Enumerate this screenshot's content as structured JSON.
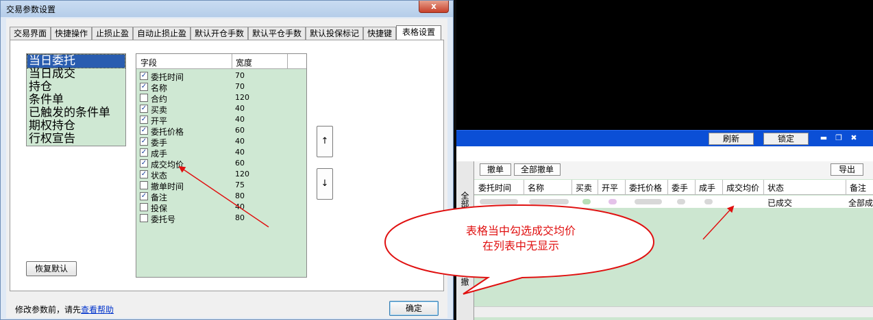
{
  "dialog": {
    "title": "交易参数设置",
    "close_label": "x",
    "tabs": [
      "交易界面",
      "快捷操作",
      "止损止盈",
      "自动止损止盈",
      "默认开仓手数",
      "默认平仓手数",
      "默认投保标记",
      "快捷键",
      "表格设置"
    ],
    "active_tab": "表格设置",
    "table_types": [
      "当日委托",
      "当日成交",
      "持仓",
      "条件单",
      "已触发的条件单",
      "期权持仓",
      "行权宣告"
    ],
    "selected_table_type": "当日委托",
    "grid_headers": {
      "field": "字段",
      "width": "宽度"
    },
    "fields": [
      {
        "name": "委托时间",
        "width": "70",
        "checked": "✓"
      },
      {
        "name": "名称",
        "width": "70",
        "checked": "✓"
      },
      {
        "name": "合约",
        "width": "120",
        "checked": ""
      },
      {
        "name": "买卖",
        "width": "40",
        "checked": "✓"
      },
      {
        "name": "开平",
        "width": "40",
        "checked": "✓"
      },
      {
        "name": "委托价格",
        "width": "60",
        "checked": "✓"
      },
      {
        "name": "委手",
        "width": "40",
        "checked": "✓"
      },
      {
        "name": "成手",
        "width": "40",
        "checked": "✓"
      },
      {
        "name": "成交均价",
        "width": "60",
        "checked": "✓"
      },
      {
        "name": "状态",
        "width": "120",
        "checked": "✓"
      },
      {
        "name": "撤单时间",
        "width": "75",
        "checked": ""
      },
      {
        "name": "备注",
        "width": "80",
        "checked": "✓"
      },
      {
        "name": "投保",
        "width": "40",
        "checked": ""
      },
      {
        "name": "委托号",
        "width": "80",
        "checked": ""
      }
    ],
    "move_up_label": "↑",
    "move_down_label": "↓",
    "restore_default_label": "恢复默认",
    "footer_note": "修改参数前，请先",
    "help_link": "查看帮助",
    "ok_label": "确定"
  },
  "terminal": {
    "refresh_label": "刷新",
    "lock_label": "锁定",
    "withdraw_label": "撤单",
    "withdraw_all_label": "全部撤单",
    "export_label": "导出",
    "side_label_top": "全部",
    "side_label_bottom": "可撤",
    "columns": [
      "委托时间",
      "名称",
      "买卖",
      "开平",
      "委托价格",
      "委手",
      "成手",
      "成交均价",
      "状态",
      "备注"
    ],
    "row_status": "已成交",
    "row_remark": "全部成"
  },
  "annotation": {
    "line1": "表格当中勾选成交均价",
    "line2": "在列表中无显示",
    "color": "#e01010"
  }
}
